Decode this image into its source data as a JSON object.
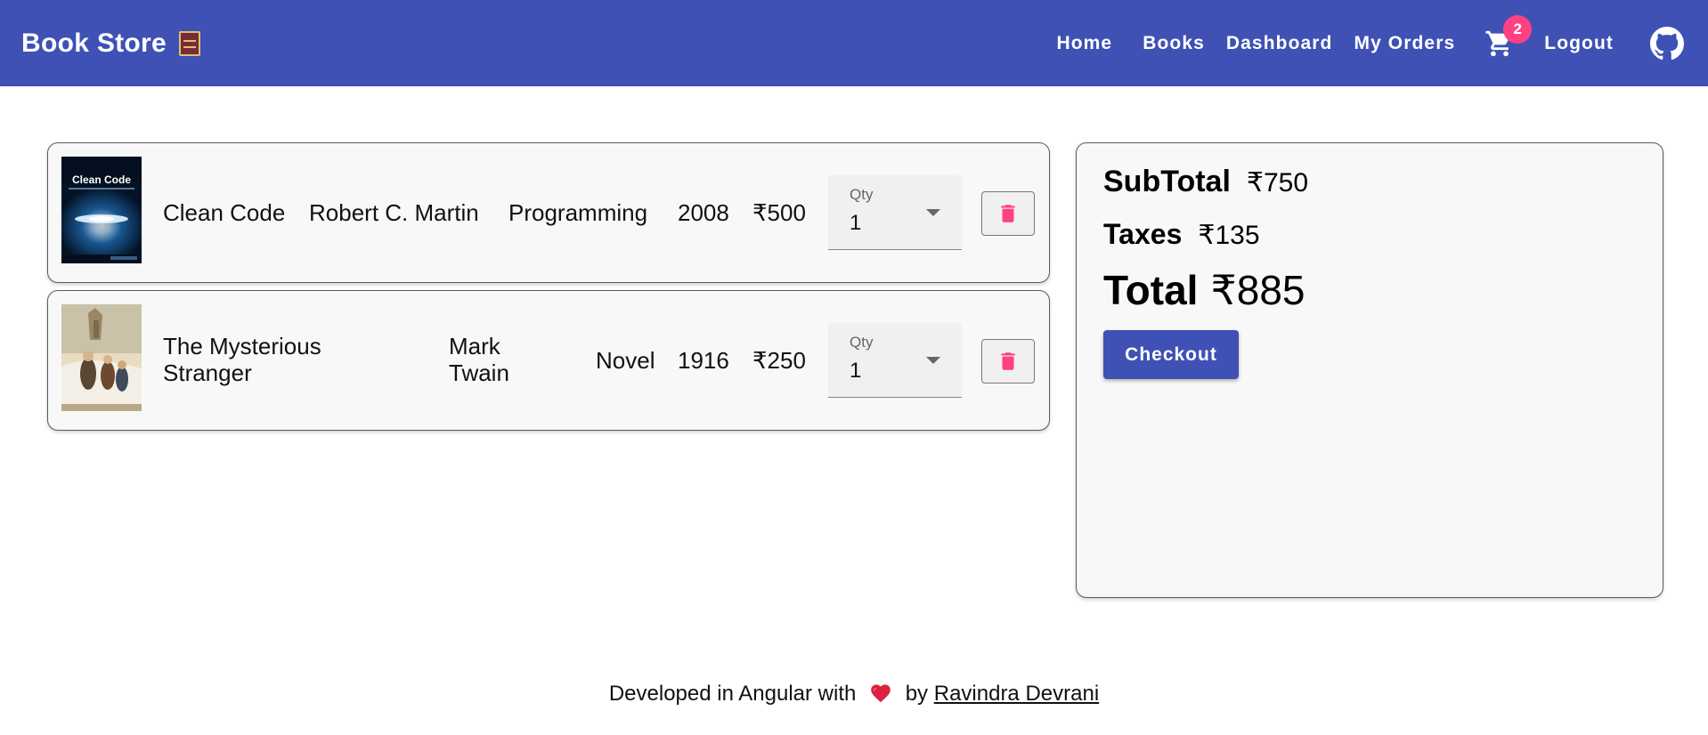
{
  "app": {
    "brand": "Book Store",
    "brand_icon": "books-icon"
  },
  "nav": {
    "items": [
      {
        "label": "Home"
      },
      {
        "label": "Books"
      },
      {
        "label": "Dashboard"
      },
      {
        "label": "My Orders"
      }
    ],
    "cart_count": "2",
    "logout_label": "Logout",
    "github_icon": "github-icon"
  },
  "cart": {
    "qty_label": "Qty",
    "items": [
      {
        "title": "Clean Code",
        "author": "Robert C. Martin",
        "category": "Programming",
        "year": "2008",
        "price": "₹500",
        "qty": "1",
        "cover_text": "Clean Code"
      },
      {
        "title": "The Mysterious Stranger",
        "author": "Mark Twain",
        "category": "Novel",
        "year": "1916",
        "price": "₹250",
        "qty": "1"
      }
    ]
  },
  "summary": {
    "subtotal_label": "SubTotal",
    "subtotal_value": "₹750",
    "taxes_label": "Taxes",
    "taxes_value": "₹135",
    "total_label": "Total",
    "total_value": "₹885",
    "checkout_label": "Checkout"
  },
  "footer": {
    "text_before": "Developed in Angular with",
    "text_by": "by",
    "author_link": "Ravindra Devrani"
  },
  "colors": {
    "primary": "#3f51b5",
    "accent": "#ff4081",
    "card_bg": "#f8f8f8"
  }
}
